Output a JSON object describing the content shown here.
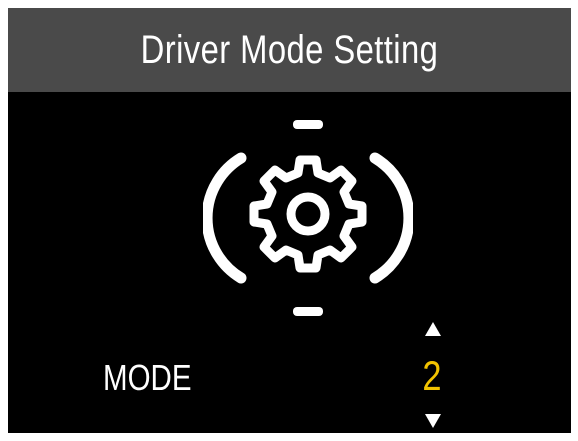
{
  "title": "Driver Mode Setting",
  "icon": "driver-mode-gear-icon",
  "mode": {
    "label": "MODE",
    "value": "2"
  },
  "colors": {
    "background": "#000000",
    "title_bar": "#4a4a4a",
    "text": "#ffffff",
    "value": "#f2c300"
  }
}
